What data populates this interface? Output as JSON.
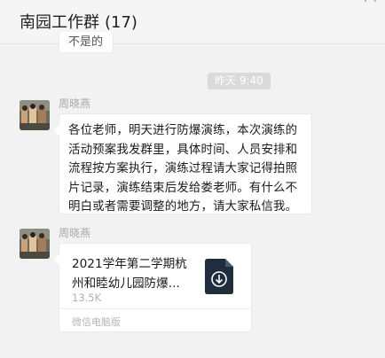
{
  "window": {
    "title": "南园工作群",
    "member_count": "(17)",
    "top_dots": "· ·"
  },
  "previous_message": {
    "text": "不是的"
  },
  "timestamp": {
    "label": "昨天 9:40"
  },
  "messages": [
    {
      "sender": "周晓燕",
      "text": "各位老师，明天进行防爆演练，本次演练的活动预案我发群里，具体时间、人员安排和流程按方案执行，演练过程请大家记得拍照片记录，演练结束后发给娄老师。有什么不明白或者需要调整的地方，请大家私信我。"
    },
    {
      "sender": "周晓燕",
      "file": {
        "name": "2021学年第二学期杭州和睦幼儿园防爆...",
        "size": "13.5K",
        "source": "微信电脑版",
        "icon": "file-download-icon"
      }
    }
  ],
  "colors": {
    "background": "#f2f2f2",
    "bubble": "#ffffff",
    "file_icon": "#1f2d3d",
    "time_pill": "#dadada"
  }
}
